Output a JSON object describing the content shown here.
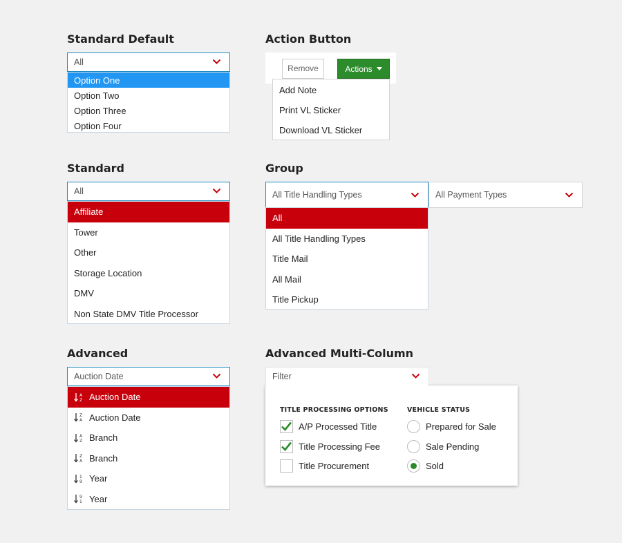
{
  "colors": {
    "accent_blue": "#1e8bc3",
    "highlight_blue": "#2196f3",
    "highlight_red": "#c8000b",
    "action_green": "#2c8c2c",
    "chevron_red": "#c8000b"
  },
  "standard_default": {
    "heading": "Standard Default",
    "selected": "All",
    "options": [
      "Option One",
      "Option Two",
      "Option Three",
      "Option Four"
    ]
  },
  "action_button": {
    "heading": "Action Button",
    "remove_label": "Remove",
    "actions_label": "Actions",
    "menu": [
      "Add Note",
      "Print VL Sticker",
      "Download VL Sticker"
    ]
  },
  "standard": {
    "heading": "Standard",
    "selected": "All",
    "options": [
      "Affiliate",
      "Tower",
      "Other",
      "Storage Location",
      "DMV",
      "Non State DMV Title Processor"
    ]
  },
  "group": {
    "heading": "Group",
    "select1": "All Title Handling Types",
    "select2": "All Payment Types",
    "options": [
      "All",
      "All Title Handling Types",
      "Title Mail",
      "All Mail",
      "Title Pickup"
    ]
  },
  "advanced": {
    "heading": "Advanced",
    "selected": "Auction Date",
    "options": [
      {
        "label": "Auction Date",
        "icon": "sort-a-z-icon"
      },
      {
        "label": "Auction Date",
        "icon": "sort-z-a-icon"
      },
      {
        "label": "Branch",
        "icon": "sort-a-z-icon"
      },
      {
        "label": "Branch",
        "icon": "sort-z-a-icon"
      },
      {
        "label": "Year",
        "icon": "sort-1-9-icon"
      },
      {
        "label": "Year",
        "icon": "sort-9-1-icon"
      }
    ]
  },
  "multi_column": {
    "heading": "Advanced Multi-Column",
    "filter_label": "Filter",
    "col1_heading": "TITLE PROCESSING OPTIONS",
    "col1_options": [
      {
        "label": "A/P Processed Title",
        "checked": true
      },
      {
        "label": "Title Processing Fee",
        "checked": true
      },
      {
        "label": "Title Procurement",
        "checked": false
      }
    ],
    "col2_heading": "VEHICLE STATUS",
    "col2_options": [
      {
        "label": "Prepared for Sale",
        "selected": false
      },
      {
        "label": "Sale Pending",
        "selected": false
      },
      {
        "label": "Sold",
        "selected": true
      }
    ]
  }
}
